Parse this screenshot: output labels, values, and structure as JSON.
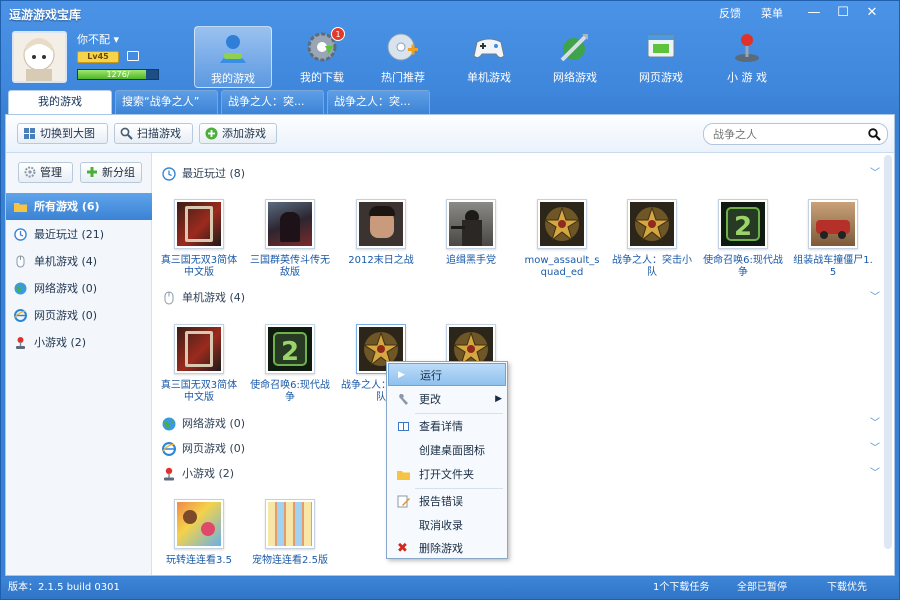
{
  "window": {
    "title": "逗游游戏宝库",
    "links": {
      "feedback": "反馈",
      "menu": "菜单"
    },
    "controls": {
      "minimize": "—",
      "maximize": "☐",
      "close": "✕"
    }
  },
  "user": {
    "name": "你不配",
    "level": "Lv45",
    "xp": "1276/",
    "xp_percent": 85
  },
  "nav": [
    {
      "label": "我的游戏"
    },
    {
      "label": "我的下载",
      "badge": "1"
    },
    {
      "label": "热门推荐"
    },
    {
      "label": "单机游戏"
    },
    {
      "label": "网络游戏"
    },
    {
      "label": "网页游戏"
    },
    {
      "label": "小 游 戏"
    }
  ],
  "tabs": [
    {
      "label": "我的游戏"
    },
    {
      "label": "搜索“战争之人”"
    },
    {
      "label": "战争之人：突..."
    },
    {
      "label": "战争之人：突..."
    }
  ],
  "toolbar": {
    "switch": "切换到大图",
    "scan": "扫描游戏",
    "add": "添加游戏"
  },
  "search": {
    "placeholder": "战争之人"
  },
  "sidebar": {
    "manage": "管理",
    "new_group": "新分组",
    "items": [
      {
        "label": "所有游戏 (6)"
      },
      {
        "label": "最近玩过 (21)"
      },
      {
        "label": "单机游戏 (4)"
      },
      {
        "label": "网络游戏 (0)"
      },
      {
        "label": "网页游戏 (0)"
      },
      {
        "label": "小游戏 (2)"
      }
    ]
  },
  "sections": {
    "recent": "最近玩过 (8)",
    "single": "单机游戏 (4)",
    "online": "网络游戏 (0)",
    "web": "网页游戏 (0)",
    "mini": "小游戏 (2)"
  },
  "recent_games": [
    {
      "name": "真三国无双3简体中文版"
    },
    {
      "name": "三国群英传斗传无敌版"
    },
    {
      "name": "2012末日之战"
    },
    {
      "name": "追缉黑手党"
    },
    {
      "name": "mow_assault_squad_ed"
    },
    {
      "name": "战争之人：突击小队"
    },
    {
      "name": "使命召唤6:现代战争"
    },
    {
      "name": "组装战车撞僵尸1.5"
    }
  ],
  "single_games": [
    {
      "name": "真三国无双3简体中文版"
    },
    {
      "name": "使命召唤6:现代战争"
    },
    {
      "name": "战争之人：突击小队"
    },
    {
      "name": ""
    }
  ],
  "mini_games": [
    {
      "name": "玩转连连看3.5"
    },
    {
      "name": "宠物连连看2.5版"
    }
  ],
  "context_menu": {
    "run": "运行",
    "change": "更改",
    "details": "查看详情",
    "shortcut": "创建桌面图标",
    "open_folder": "打开文件夹",
    "report": "报告错误",
    "uncollect": "取消收录",
    "delete": "删除游戏"
  },
  "status": {
    "version": "版本：2.1.5 build 0301",
    "tasks": "1个下载任务",
    "paused": "全部已暂停",
    "priority": "下载优先"
  }
}
